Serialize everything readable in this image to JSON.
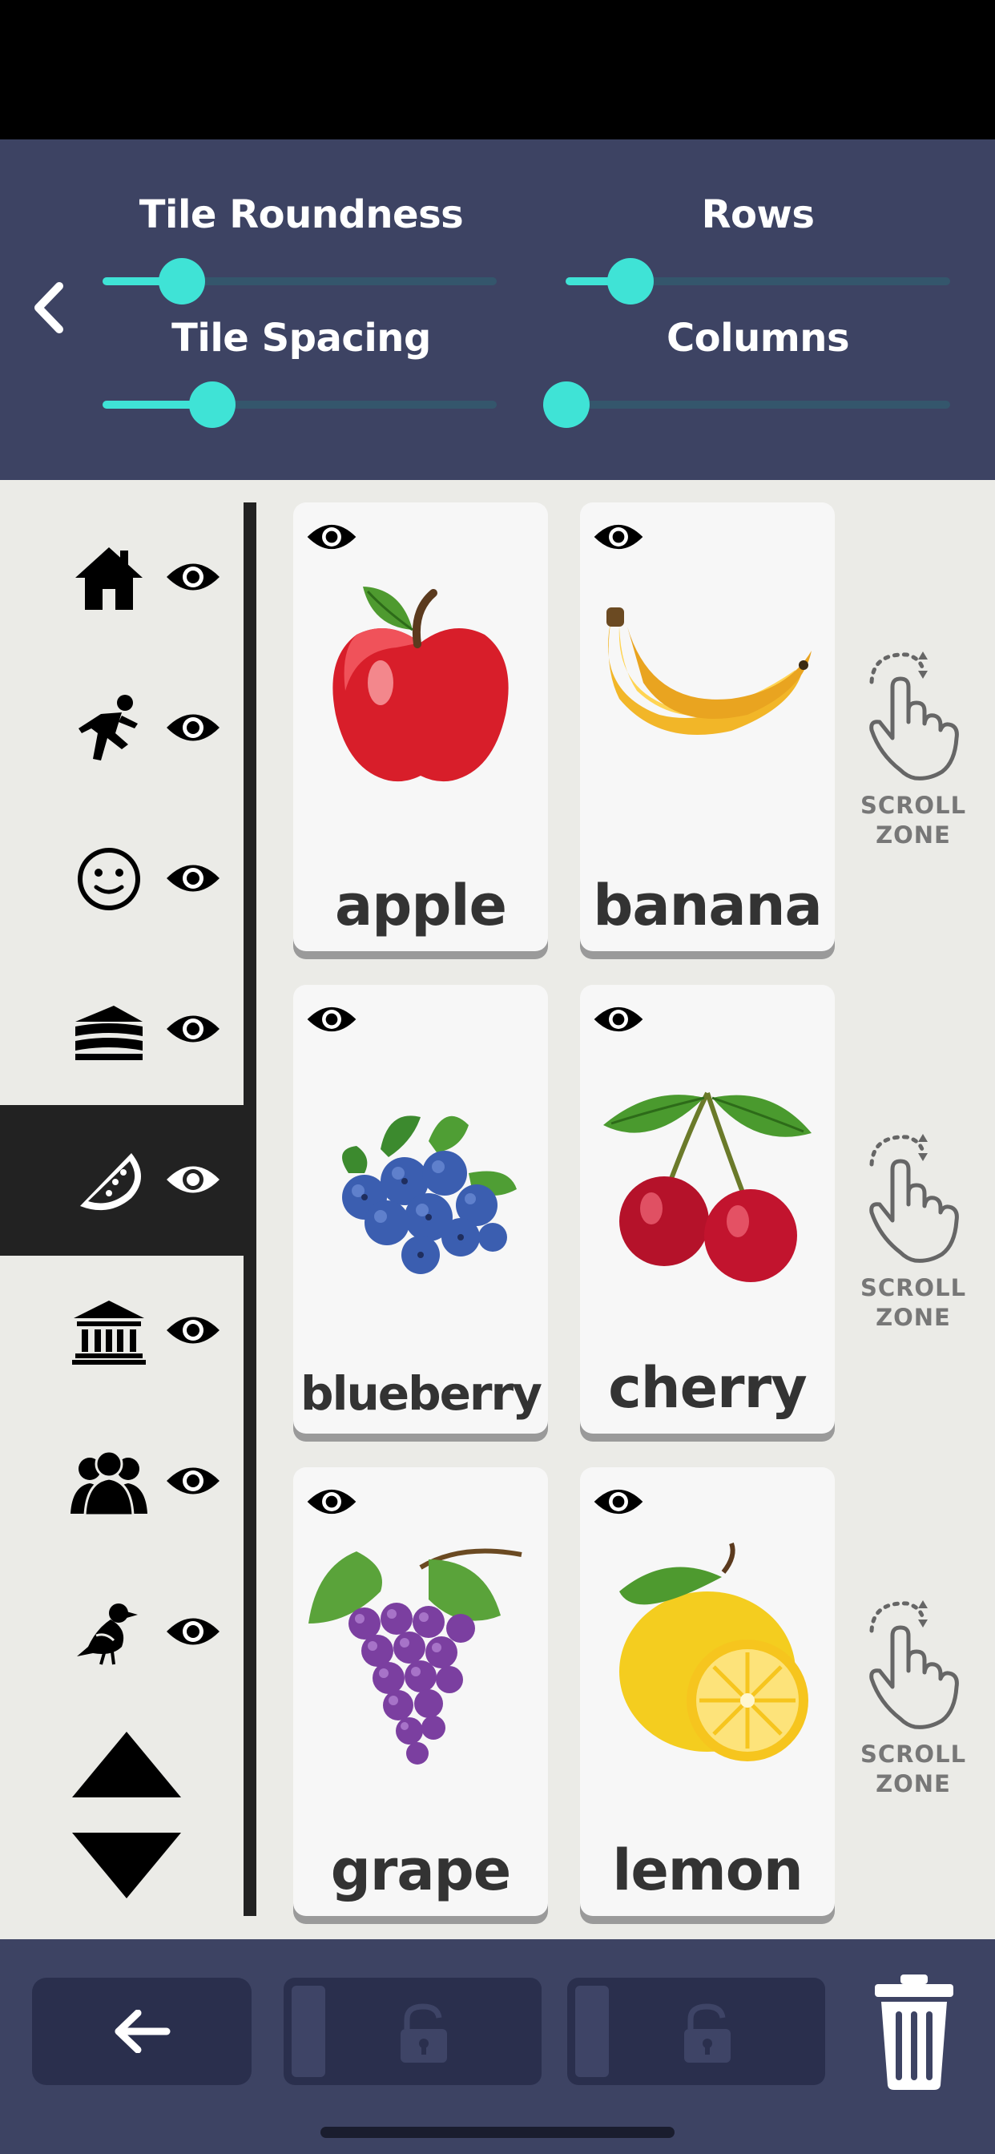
{
  "settings": {
    "back_icon": "chevron-left-icon",
    "sliders": [
      {
        "label": "Tile Roundness",
        "value_fraction": 0.2
      },
      {
        "label": "Rows",
        "value_fraction": 0.17
      },
      {
        "label": "Tile Spacing",
        "value_fraction": 0.28
      },
      {
        "label": "Columns",
        "value_fraction": 0.0
      }
    ],
    "accent_color": "#3fe3d6",
    "background_color": "#3d4363"
  },
  "sidebar": {
    "categories": [
      {
        "icon": "home-icon",
        "visible_icon": "eye-icon",
        "active": false
      },
      {
        "icon": "running-person-icon",
        "visible_icon": "eye-icon",
        "active": false
      },
      {
        "icon": "smiley-face-icon",
        "visible_icon": "eye-icon",
        "active": false
      },
      {
        "icon": "cake-slice-icon",
        "visible_icon": "eye-icon",
        "active": false
      },
      {
        "icon": "watermelon-slice-icon",
        "visible_icon": "eye-icon",
        "active": true
      },
      {
        "icon": "museum-building-icon",
        "visible_icon": "eye-icon",
        "active": false
      },
      {
        "icon": "people-group-icon",
        "visible_icon": "eye-icon",
        "active": false
      },
      {
        "icon": "bird-icon",
        "visible_icon": "eye-icon",
        "active": false
      }
    ],
    "up_icon": "triangle-up-icon",
    "down_icon": "triangle-down-icon"
  },
  "tiles": [
    {
      "label": "apple",
      "image": "apple-image"
    },
    {
      "label": "banana",
      "image": "banana-image"
    },
    {
      "label": "blueberry",
      "image": "blueberry-image"
    },
    {
      "label": "cherry",
      "image": "cherry-image"
    },
    {
      "label": "grape",
      "image": "grape-image"
    },
    {
      "label": "lemon",
      "image": "lemon-image"
    }
  ],
  "scroll_zones": [
    {
      "line1": "SCROLL",
      "line2": "ZONE"
    },
    {
      "line1": "SCROLL",
      "line2": "ZONE"
    },
    {
      "line1": "SCROLL",
      "line2": "ZONE"
    }
  ],
  "bottom_bar": {
    "back_icon": "arrow-left-icon",
    "slots": [
      {
        "icon": "unlock-icon"
      },
      {
        "icon": "unlock-icon"
      }
    ],
    "trash_icon": "trash-icon"
  }
}
